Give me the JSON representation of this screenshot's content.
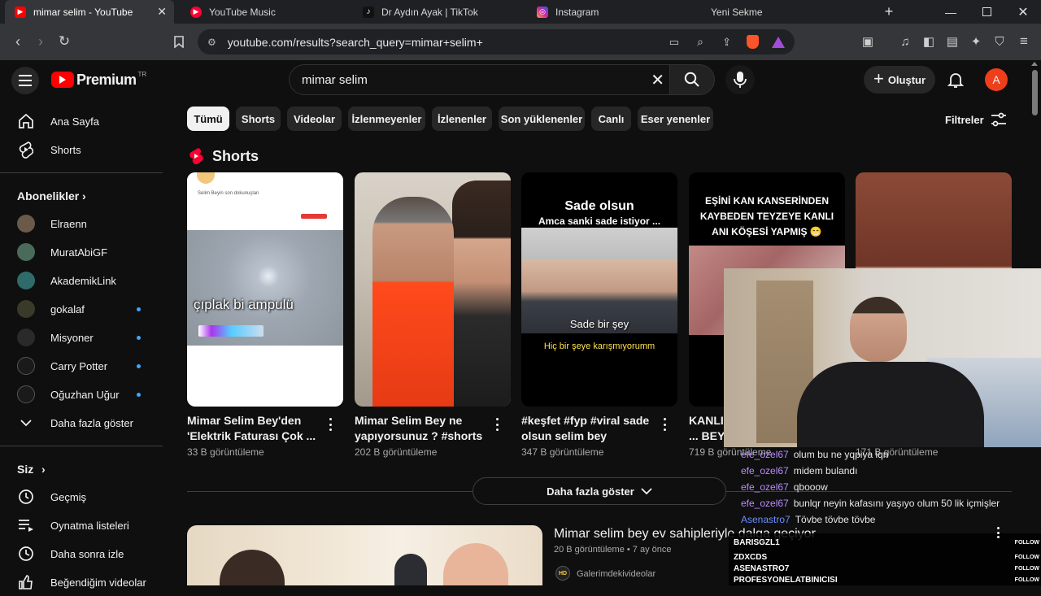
{
  "browser": {
    "tabs": [
      {
        "label": "mimar selim - YouTube",
        "active": true
      },
      {
        "label": "YouTube Music",
        "active": false
      },
      {
        "label": "Dr Aydın Ayak | TikTok",
        "active": false
      },
      {
        "label": "Instagram",
        "active": false
      },
      {
        "label": "Yeni Sekme",
        "active": false
      }
    ],
    "url": "youtube.com/results?search_query=mimar+selim+"
  },
  "youtube": {
    "logo_text": "Premium",
    "logo_region": "TR",
    "search_value": "mimar selim",
    "create_label": "Oluştur",
    "avatar_letter": "A",
    "filters_label": "Filtreler",
    "chips": [
      "Tümü",
      "Shorts",
      "Videolar",
      "İzlenmeyenler",
      "İzlenenler",
      "Son yüklenenler",
      "Canlı",
      "Eser yenenler"
    ],
    "shorts_heading": "Shorts",
    "shorts": [
      {
        "title": "Mimar Selim Bey'den 'Elektrik Faturası Çok ...",
        "views": "33 B görüntüleme",
        "overlay": "çıplak bi ampulü",
        "top_text": "Selim Beyin son dokunuşları"
      },
      {
        "title": "Mimar Selim Bey ne yapıyorsunuz ? #shorts",
        "views": "202 B görüntüleme"
      },
      {
        "title": "#keşfet #fyp #viral sade olsun selim bey",
        "views": "347 B görüntüleme",
        "top_line1": "Sade olsun",
        "top_line2": "Amca sanki sade istiyor ...",
        "caption1": "Sade bir şey",
        "caption2": "Hiç bir şeye karışmıyorumm"
      },
      {
        "title": "KANLI ... BEY NE...",
        "views": "719 B görüntüleme",
        "top_text": "EŞİNİ KAN KANSERİNDEN KAYBEDEN TEYZEYE KANLI ANI KÖŞESİ YAPMIŞ 😁"
      },
      {
        "title": "",
        "views": "171 B görüntüleme"
      }
    ],
    "show_more": "Daha fazla göster",
    "video": {
      "title": "Mimar selim bey ev sahipleriyle dalga geçiyor",
      "meta": "20 B görüntüleme • 7 ay önce",
      "channel": "Galerimdekivideolar",
      "channel_badge": "HD"
    },
    "sidebar": {
      "home": "Ana Sayfa",
      "shorts": "Shorts",
      "subs_heading": "Abonelikler",
      "subs": [
        {
          "name": "Elraenn",
          "dot": false,
          "color": "#6b5a4a"
        },
        {
          "name": "MuratAbiGF",
          "dot": false,
          "color": "#4a6b5a"
        },
        {
          "name": "AkademikLink",
          "dot": false,
          "color": "#2f6b6b"
        },
        {
          "name": "gokalaf",
          "dot": true,
          "color": "#3a3a2a"
        },
        {
          "name": "Misyoner",
          "dot": true,
          "color": "#2a2a2a"
        },
        {
          "name": "Carry Potter",
          "dot": true,
          "color": "#1a1a1a"
        },
        {
          "name": "Oğuzhan Uğur",
          "dot": true,
          "color": "#1a1a1a"
        }
      ],
      "show_more": "Daha fazla göster",
      "you_heading": "Siz",
      "history": "Geçmiş",
      "playlists": "Oynatma listeleri",
      "watch_later": "Daha sonra izle",
      "liked": "Beğendiğim videolar"
    }
  },
  "chat": [
    {
      "user": "efe_ozel67",
      "msg": "olum bu ne yqpiya iqn"
    },
    {
      "user": "efe_ozel67",
      "msg": "midem bulandı"
    },
    {
      "user": "efe_ozel67",
      "msg": "qbooow"
    },
    {
      "user": "efe_ozel67",
      "msg": "bunlqr neyin kafasını yaşıyo olum 50 lik içmişler"
    },
    {
      "user": "Asenastro7",
      "msg": "Tövbe tövbe tövbe"
    }
  ],
  "follows": [
    {
      "name": "BARISGZL1",
      "action": "FOLLOW"
    },
    {
      "name": "ZDXCDS",
      "action": "FOLLOW"
    },
    {
      "name": "ASENASTRO7",
      "action": "FOLLOW"
    },
    {
      "name": "PROFESYONELATBINICISI",
      "action": "FOLLOW"
    }
  ],
  "colors": {
    "youtube_red": "#ff0000",
    "accent_blue": "#3ea6ff",
    "chat_user": "#b98cff"
  }
}
